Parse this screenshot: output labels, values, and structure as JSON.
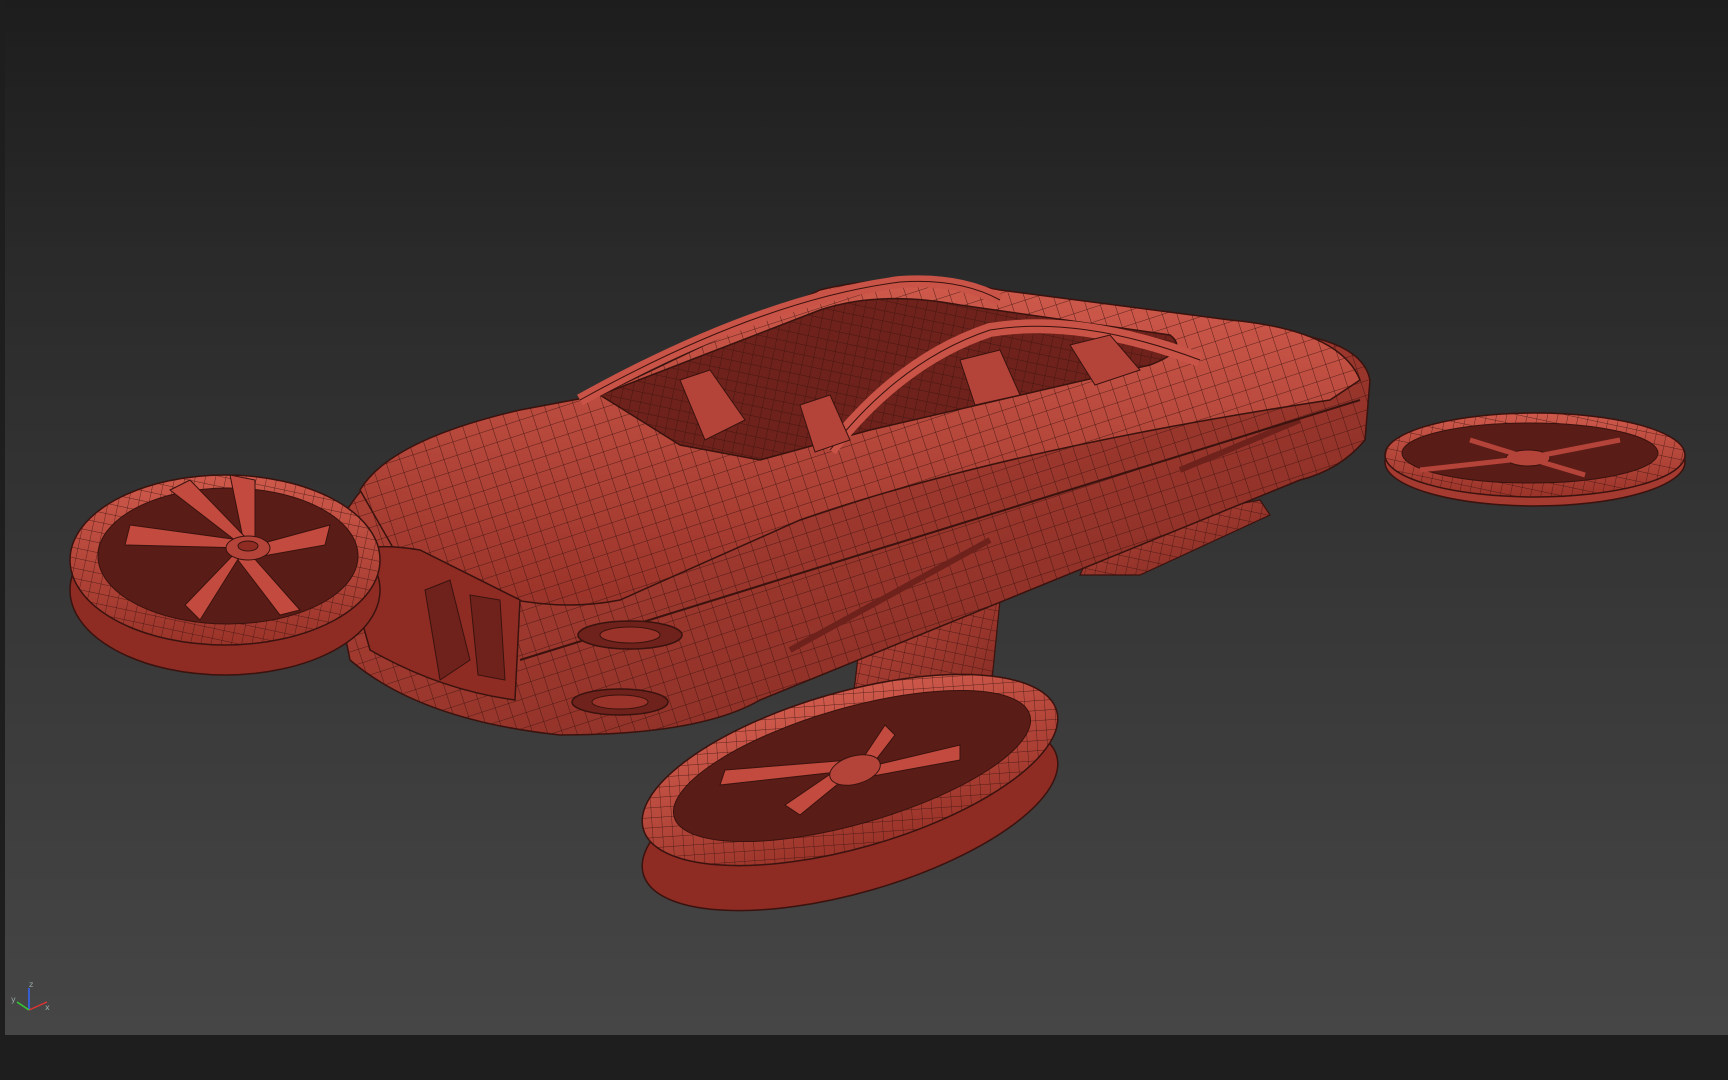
{
  "viewport": {
    "name": "perspective-viewport",
    "model": "flying-car-wireframe"
  },
  "axis_gizmo": {
    "x_label": "x",
    "y_label": "y",
    "z_label": "z"
  },
  "colors": {
    "model_fill": "#c24a3e",
    "model_shade": "#8e2c24",
    "wire": "#3a120e",
    "axis_x": "#d33",
    "axis_y": "#3c3",
    "axis_z": "#36f"
  }
}
